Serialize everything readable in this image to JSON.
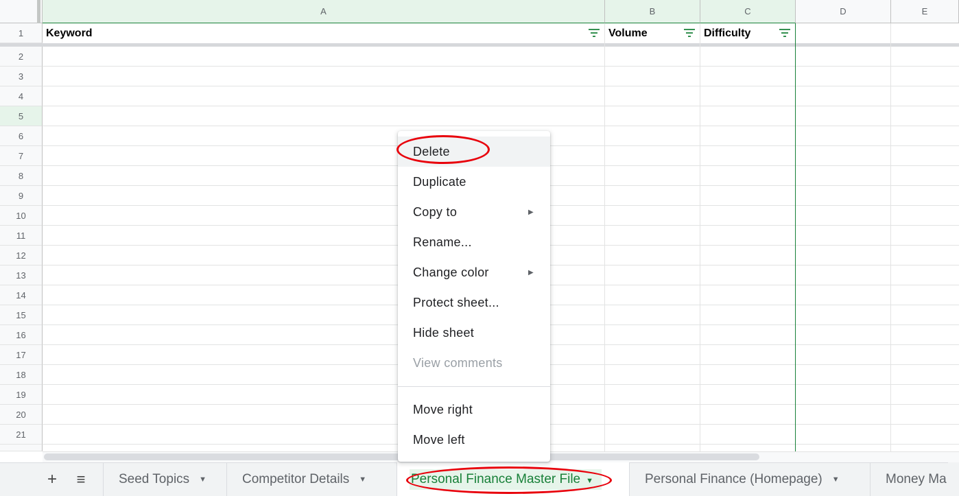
{
  "columns": {
    "a": "A",
    "b": "B",
    "c": "C",
    "d": "D",
    "e": "E"
  },
  "rows": [
    "1",
    "2",
    "3",
    "4",
    "5",
    "6",
    "7",
    "8",
    "9",
    "10",
    "11",
    "12",
    "13",
    "14",
    "15",
    "16",
    "17",
    "18",
    "19",
    "20",
    "21"
  ],
  "header_cells": {
    "keyword": "Keyword",
    "volume": "Volume",
    "difficulty": "Difficulty"
  },
  "menu": {
    "delete": "Delete",
    "duplicate": "Duplicate",
    "copy_to": "Copy to",
    "rename": "Rename...",
    "change_color": "Change color",
    "protect": "Protect sheet...",
    "hide": "Hide sheet",
    "view_comments": "View comments",
    "move_right": "Move right",
    "move_left": "Move left"
  },
  "tabs": {
    "add_icon": "+",
    "all_sheets_icon": "≡",
    "t1": "Seed Topics",
    "t2": "Competitor Details",
    "t3": "Personal Finance Master File",
    "t4": "Personal Finance (Homepage)",
    "t5": "Money Ma"
  },
  "colors": {
    "accent": "#188038",
    "annotation": "#e8000b"
  },
  "icons": {
    "filter": "filter-icon",
    "submenu": "submenu-arrow-icon",
    "tab_menu": "chevron-down-icon"
  }
}
